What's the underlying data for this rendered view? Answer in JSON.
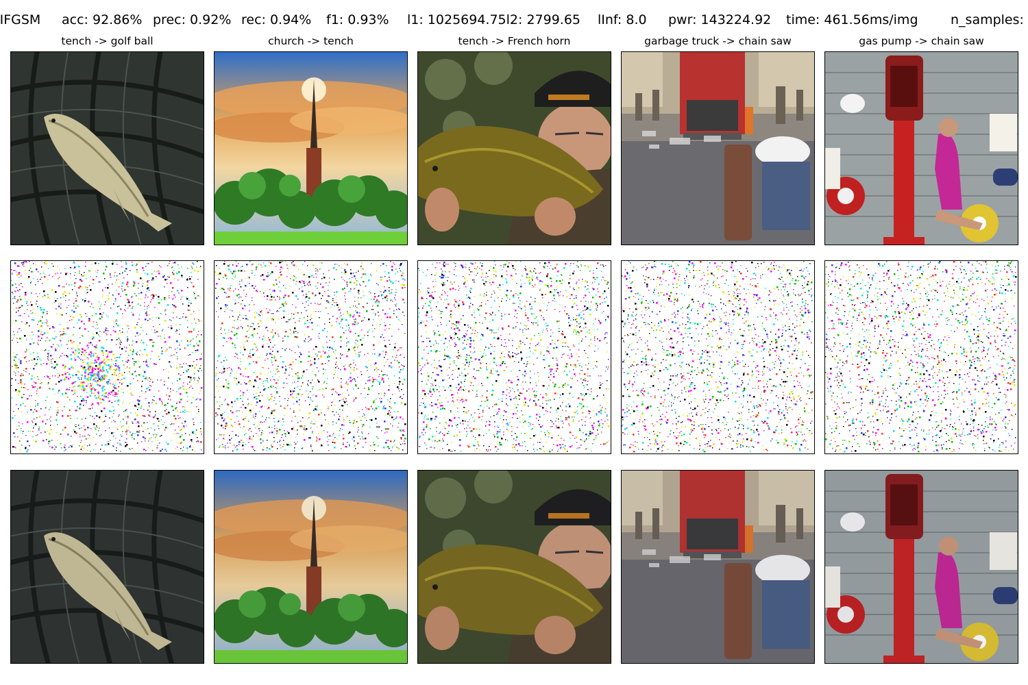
{
  "header": {
    "method": "IIFGSM",
    "acc": "acc: 92.86%",
    "prec": "prec: 0.92%",
    "rec": "rec: 0.94%",
    "f1": "f1: 0.93%",
    "l1l2": "l1: 1025694.75l2: 2799.65",
    "linf": "lInf: 8.0",
    "pwr": "pwr: 143224.92",
    "time": "time: 461.56ms/img",
    "n_samples": "n_samples:"
  },
  "columns": [
    {
      "title": "tench -> golf ball",
      "scene": "fish-in-net"
    },
    {
      "title": "church -> tench",
      "scene": "church-steeple"
    },
    {
      "title": "tench -> French horn",
      "scene": "man-holding-fish"
    },
    {
      "title": "garbage truck -> chain saw",
      "scene": "garbage-truck-street"
    },
    {
      "title": "gas pump -> chain saw",
      "scene": "gas-pump-mobiloil"
    }
  ],
  "rows": [
    "original",
    "perturbation",
    "adversarial"
  ],
  "colors": {
    "noise": [
      "#ff00ff",
      "#00e5e5",
      "#e5e500",
      "#3030ff",
      "#00c000",
      "#ff3030",
      "#000000"
    ]
  }
}
